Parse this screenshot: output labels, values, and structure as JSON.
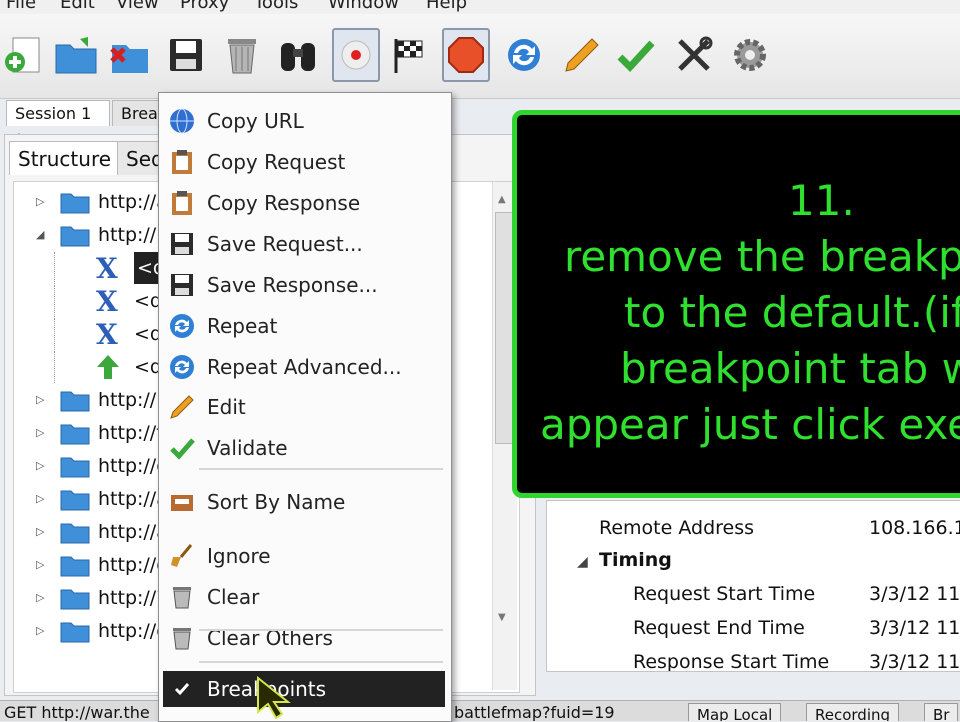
{
  "menubar": [
    "File",
    "Edit",
    "View",
    "Proxy",
    "Tools",
    "Window",
    "Help"
  ],
  "toolbar": {
    "icons": [
      "new-session-icon",
      "open-folder-icon",
      "close-session-icon",
      "save-icon",
      "trash-icon",
      "binoculars-icon",
      "record-icon",
      "finish-flag-icon",
      "stop-icon",
      "repeat-icon",
      "edit-pencil-icon",
      "validate-check-icon",
      "tools-icon",
      "settings-gear-icon"
    ]
  },
  "session_tabs": [
    "Session 1 *",
    "Break"
  ],
  "view_tabs": [
    "Structure",
    "Seq"
  ],
  "tree": [
    {
      "text": "http://a",
      "kind": "folder",
      "level": 0
    },
    {
      "text": "http://1",
      "kind": "folder",
      "level": 0
    },
    {
      "text": "<d",
      "kind": "x",
      "level": 1
    },
    {
      "text": "<de",
      "kind": "x",
      "level": 1
    },
    {
      "text": "<de",
      "kind": "x",
      "level": 1
    },
    {
      "text": "<de",
      "kind": "up",
      "level": 1
    },
    {
      "text": "http://l",
      "kind": "folder",
      "level": 0
    },
    {
      "text": "http://t",
      "kind": "folder",
      "level": 0
    },
    {
      "text": "http://d",
      "kind": "folder",
      "level": 0
    },
    {
      "text": "http://a",
      "kind": "folder",
      "level": 0
    },
    {
      "text": "http://a",
      "kind": "folder",
      "level": 0
    },
    {
      "text": "http://g",
      "kind": "folder",
      "level": 0
    },
    {
      "text": "http://7",
      "kind": "folder",
      "level": 0
    },
    {
      "text": "http://o",
      "kind": "folder",
      "level": 0
    }
  ],
  "context_menu": {
    "items": [
      {
        "label": "Copy URL",
        "icon": "globe-icon"
      },
      {
        "label": "Copy Request",
        "icon": "clipboard-icon"
      },
      {
        "label": "Copy Response",
        "icon": "clipboard-icon"
      },
      {
        "label": "Save Request...",
        "icon": "save-icon"
      },
      {
        "label": "Save Response...",
        "icon": "save-icon"
      },
      {
        "label": "Repeat",
        "icon": "repeat-icon"
      },
      {
        "label": "Repeat Advanced...",
        "icon": "repeat-icon"
      },
      {
        "label": "Edit",
        "icon": "pencil-icon"
      },
      {
        "label": "Validate",
        "icon": "check-icon"
      },
      {
        "label": "Sort By Name",
        "icon": "tray-icon"
      },
      {
        "label": "Ignore",
        "icon": "broom-icon"
      },
      {
        "label": "Clear",
        "icon": "trash-icon"
      },
      {
        "label": "Clear Others",
        "icon": "trash-icon"
      },
      {
        "label": "Breakpoints",
        "icon": "checkmark-icon"
      }
    ]
  },
  "overlay": {
    "lines": [
      "11.",
      "remove the breakp",
      "to the default.(if",
      "breakpoint tab w",
      "appear just click exe"
    ],
    "colors": {
      "text": "#2fe02f",
      "border": "#2fd42f",
      "bg": "#000000"
    }
  },
  "properties": {
    "remote_address_label": "Remote Address",
    "remote_address_value": "108.166.11",
    "timing_label": "Timing",
    "request_start_label": "Request Start Time",
    "request_start_value": "3/3/12 11:",
    "request_end_label": "Request End Time",
    "request_end_value": "3/3/12 11:",
    "response_start_label": "Response Start Time",
    "response_start_value": "3/3/12 11:"
  },
  "statusbar": {
    "text": "GET http://war.the",
    "mid_text": "battlefmap?fuid=19",
    "buttons": [
      "Map Local",
      "Recording",
      "Br"
    ]
  }
}
